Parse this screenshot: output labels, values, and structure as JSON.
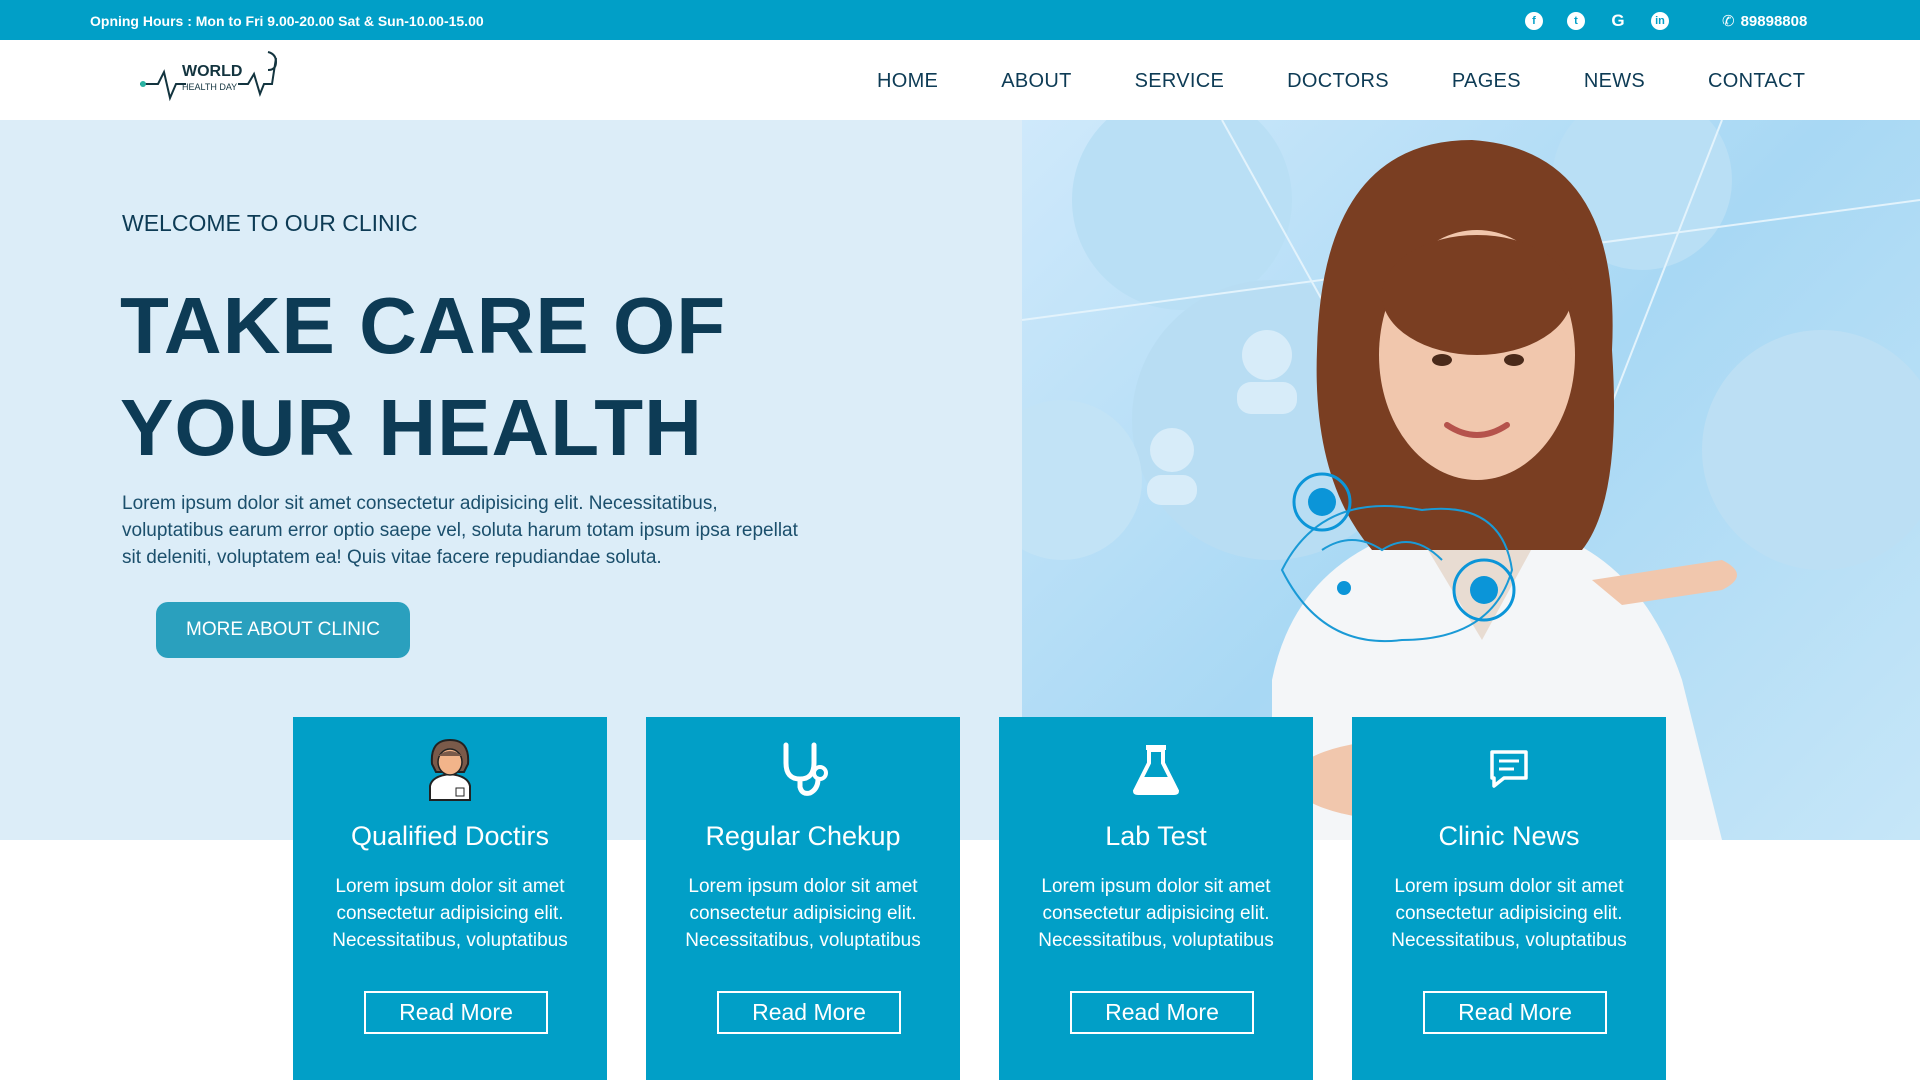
{
  "topbar": {
    "hours": "Opning Hours : Mon to Fri 9.00-20.00 Sat & Sun-10.00-15.00",
    "socials": [
      "facebook-icon",
      "twitter-icon",
      "google-icon",
      "linkedin-icon"
    ],
    "phone": "89898808"
  },
  "logo": {
    "line1": "WORLD",
    "line2": "HEALTH DAY"
  },
  "nav": [
    "HOME",
    "ABOUT",
    "SERVICE",
    "DOCTORS",
    "PAGES",
    "NEWS",
    "CONTACT"
  ],
  "hero": {
    "welcome": "WELCOME TO OUR CLINIC",
    "headline_1": "TAKE CARE OF",
    "headline_2": "YOUR HEALTH",
    "lead": "Lorem ipsum dolor sit amet consectetur adipisicing elit. Necessitatibus, voluptatibus earum error optio saepe vel, soluta harum totam ipsum ipsa repellat sit deleniti, voluptatem ea! Quis vitae facere repudiandae soluta.",
    "cta": "MORE ABOUT CLINIC"
  },
  "cards": [
    {
      "title": "Qualified Doctirs",
      "text": "Lorem ipsum dolor sit amet consectetur adipisicing elit. Necessitatibus, voluptatibus",
      "button": "Read More",
      "icon": "doctor-icon"
    },
    {
      "title": "Regular Chekup",
      "text": "Lorem ipsum dolor sit amet consectetur adipisicing elit. Necessitatibus, voluptatibus",
      "button": "Read More",
      "icon": "stethoscope-icon"
    },
    {
      "title": "Lab Test",
      "text": "Lorem ipsum dolor sit amet consectetur adipisicing elit. Necessitatibus, voluptatibus",
      "button": "Read More",
      "icon": "flask-icon"
    },
    {
      "title": "Clinic News",
      "text": "Lorem ipsum dolor sit amet consectetur adipisicing elit. Necessitatibus, voluptatibus",
      "button": "Read More",
      "icon": "chat-icon"
    }
  ],
  "colors": {
    "topbar": "#019fc7",
    "card": "#019fc7",
    "hero_bg": "#dcedf8",
    "heading": "#0d3b55",
    "cta": "#2aa0be"
  }
}
